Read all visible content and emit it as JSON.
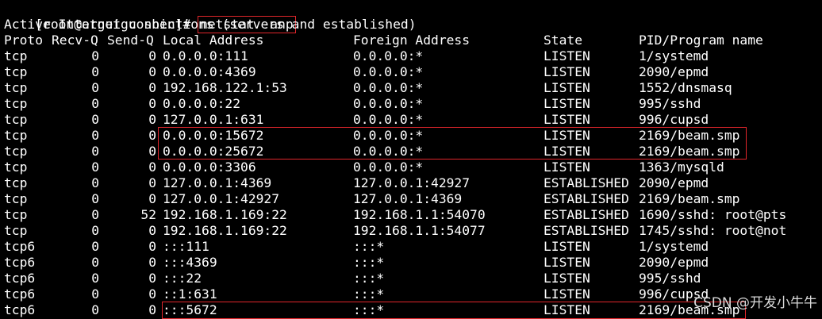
{
  "prompt": {
    "text": "[root@atguigu sbin]# ",
    "command": "netstat -anp"
  },
  "title_line": "Active Internet connections (servers and established)",
  "columns": {
    "proto": "Proto",
    "recv": "Recv-Q",
    "send": "Send-Q",
    "local": "Local Address",
    "foreign": "Foreign Address",
    "state": "State",
    "pid": "PID/Program name"
  },
  "rows": [
    {
      "proto": "tcp",
      "recv": "0",
      "send": "0",
      "local": "0.0.0.0:111",
      "foreign": "0.0.0.0:*",
      "state": "LISTEN",
      "pid": "1/systemd"
    },
    {
      "proto": "tcp",
      "recv": "0",
      "send": "0",
      "local": "0.0.0.0:4369",
      "foreign": "0.0.0.0:*",
      "state": "LISTEN",
      "pid": "2090/epmd"
    },
    {
      "proto": "tcp",
      "recv": "0",
      "send": "0",
      "local": "192.168.122.1:53",
      "foreign": "0.0.0.0:*",
      "state": "LISTEN",
      "pid": "1552/dnsmasq"
    },
    {
      "proto": "tcp",
      "recv": "0",
      "send": "0",
      "local": "0.0.0.0:22",
      "foreign": "0.0.0.0:*",
      "state": "LISTEN",
      "pid": "995/sshd"
    },
    {
      "proto": "tcp",
      "recv": "0",
      "send": "0",
      "local": "127.0.0.1:631",
      "foreign": "0.0.0.0:*",
      "state": "LISTEN",
      "pid": "996/cupsd"
    },
    {
      "proto": "tcp",
      "recv": "0",
      "send": "0",
      "local": "0.0.0.0:15672",
      "foreign": "0.0.0.0:*",
      "state": "LISTEN",
      "pid": "2169/beam.smp"
    },
    {
      "proto": "tcp",
      "recv": "0",
      "send": "0",
      "local": "0.0.0.0:25672",
      "foreign": "0.0.0.0:*",
      "state": "LISTEN",
      "pid": "2169/beam.smp"
    },
    {
      "proto": "tcp",
      "recv": "0",
      "send": "0",
      "local": "0.0.0.0:3306",
      "foreign": "0.0.0.0:*",
      "state": "LISTEN",
      "pid": "1363/mysqld"
    },
    {
      "proto": "tcp",
      "recv": "0",
      "send": "0",
      "local": "127.0.0.1:4369",
      "foreign": "127.0.0.1:42927",
      "state": "ESTABLISHED",
      "pid": "2090/epmd"
    },
    {
      "proto": "tcp",
      "recv": "0",
      "send": "0",
      "local": "127.0.0.1:42927",
      "foreign": "127.0.0.1:4369",
      "state": "ESTABLISHED",
      "pid": "2169/beam.smp"
    },
    {
      "proto": "tcp",
      "recv": "0",
      "send": "52",
      "local": "192.168.1.169:22",
      "foreign": "192.168.1.1:54070",
      "state": "ESTABLISHED",
      "pid": "1690/sshd: root@pts"
    },
    {
      "proto": "tcp",
      "recv": "0",
      "send": "0",
      "local": "192.168.1.169:22",
      "foreign": "192.168.1.1:54077",
      "state": "ESTABLISHED",
      "pid": "1745/sshd: root@not"
    },
    {
      "proto": "tcp6",
      "recv": "0",
      "send": "0",
      "local": ":::111",
      "foreign": ":::*",
      "state": "LISTEN",
      "pid": "1/systemd"
    },
    {
      "proto": "tcp6",
      "recv": "0",
      "send": "0",
      "local": ":::4369",
      "foreign": ":::*",
      "state": "LISTEN",
      "pid": "2090/epmd"
    },
    {
      "proto": "tcp6",
      "recv": "0",
      "send": "0",
      "local": ":::22",
      "foreign": ":::*",
      "state": "LISTEN",
      "pid": "995/sshd"
    },
    {
      "proto": "tcp6",
      "recv": "0",
      "send": "0",
      "local": "::1:631",
      "foreign": ":::*",
      "state": "LISTEN",
      "pid": "996/cupsd"
    },
    {
      "proto": "tcp6",
      "recv": "0",
      "send": "0",
      "local": ":::5672",
      "foreign": ":::*",
      "state": "LISTEN",
      "pid": "2169/beam.smp"
    }
  ],
  "watermark": "CSDN @开发小牛牛",
  "colors": {
    "background": "#000000",
    "text": "#ffffff",
    "highlight": "#e0262b"
  }
}
